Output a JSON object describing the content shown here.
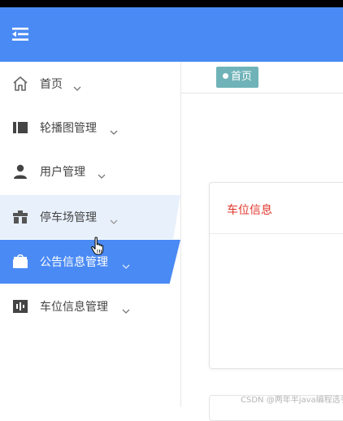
{
  "header": {
    "menu_toggle_icon": "menu-fold-icon",
    "bg_color": "#4a8af4"
  },
  "sidebar": {
    "items": [
      {
        "label": "首页",
        "icon": "home-icon",
        "state": "normal"
      },
      {
        "label": "轮播图管理",
        "icon": "carousel-icon",
        "state": "normal"
      },
      {
        "label": "用户管理",
        "icon": "user-icon",
        "state": "normal"
      },
      {
        "label": "停车场管理",
        "icon": "parking-icon",
        "state": "hover"
      },
      {
        "label": "公告信息管理",
        "icon": "announcement-icon",
        "state": "active"
      },
      {
        "label": "车位信息管理",
        "icon": "parking-space-icon",
        "state": "normal"
      }
    ],
    "active_color": "#4a8af4",
    "hover_color": "#e8f0fb"
  },
  "tabs": [
    {
      "label": "首页",
      "active": true
    }
  ],
  "main": {
    "card": {
      "title": "车位信息",
      "title_color": "#e0362c"
    }
  },
  "watermark": "CSDN @两年半java编程选手"
}
